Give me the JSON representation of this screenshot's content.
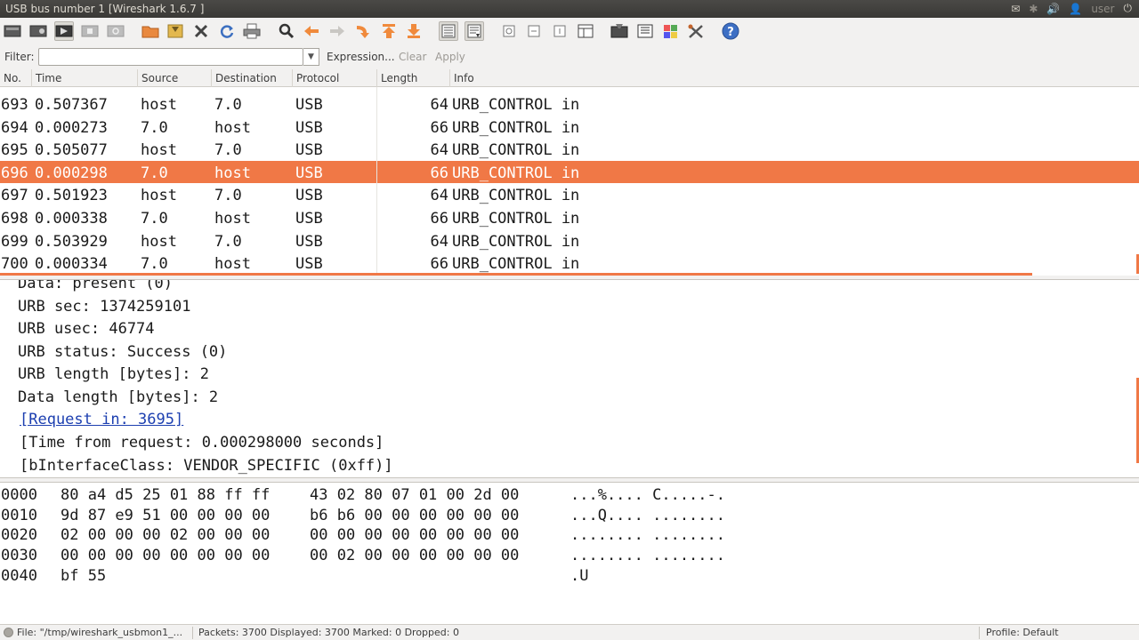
{
  "window": {
    "title": "USB bus number 1   [Wireshark 1.6.7 ]",
    "user": "user"
  },
  "toolbar": {
    "icons": [
      "interface-list-icon",
      "capture-options-icon",
      "start-capture-icon",
      "stop-capture-icon",
      "restart-capture-icon",
      "open-file-icon",
      "save-file-icon",
      "close-file-icon",
      "reload-icon",
      "print-icon",
      "find-icon",
      "go-back-icon",
      "go-forward-icon",
      "go-to-packet-icon",
      "go-first-icon",
      "go-last-icon",
      "colorize-icon",
      "autoscroll-icon",
      "zoom-in-icon",
      "zoom-out-icon",
      "normal-size-icon",
      "resize-columns-icon",
      "capture-filters-icon",
      "display-filters-icon",
      "coloring-rules-icon",
      "preferences-icon",
      "help-icon"
    ]
  },
  "filter": {
    "label": "Filter:",
    "value": "",
    "expression": "Expression...",
    "clear": "Clear",
    "apply": "Apply"
  },
  "packet_list": {
    "columns": [
      "No.",
      "Time",
      "Source",
      "Destination",
      "Protocol",
      "Length",
      "Info"
    ],
    "rows": [
      {
        "no": "693",
        "time": "0.507367",
        "src": "host",
        "dst": "7.0",
        "proto": "USB",
        "len": "64",
        "info": "URB_CONTROL in"
      },
      {
        "no": "694",
        "time": "0.000273",
        "src": "7.0",
        "dst": "host",
        "proto": "USB",
        "len": "66",
        "info": "URB_CONTROL in"
      },
      {
        "no": "695",
        "time": "0.505077",
        "src": "host",
        "dst": "7.0",
        "proto": "USB",
        "len": "64",
        "info": "URB_CONTROL in"
      },
      {
        "no": "696",
        "time": "0.000298",
        "src": "7.0",
        "dst": "host",
        "proto": "USB",
        "len": "66",
        "info": "URB_CONTROL in"
      },
      {
        "no": "697",
        "time": "0.501923",
        "src": "host",
        "dst": "7.0",
        "proto": "USB",
        "len": "64",
        "info": "URB_CONTROL in"
      },
      {
        "no": "698",
        "time": "0.000338",
        "src": "7.0",
        "dst": "host",
        "proto": "USB",
        "len": "66",
        "info": "URB_CONTROL in"
      },
      {
        "no": "699",
        "time": "0.503929",
        "src": "host",
        "dst": "7.0",
        "proto": "USB",
        "len": "64",
        "info": "URB_CONTROL in"
      },
      {
        "no": "700",
        "time": "0.000334",
        "src": "7.0",
        "dst": "host",
        "proto": "USB",
        "len": "66",
        "info": "URB_CONTROL in"
      }
    ],
    "selected_no": "696",
    "selection_color": "#f07846"
  },
  "details": {
    "lines": [
      "Data: present (0)",
      "URB sec: 1374259101",
      "URB usec: 46774",
      "URB status: Success (0)",
      "URB length [bytes]: 2",
      "Data length [bytes]: 2"
    ],
    "request_link": "[Request in: 3695]",
    "time_from_request": "[Time from request: 0.000298000 seconds]",
    "interface_class": "[bInterfaceClass: VENDOR_SPECIFIC (0xff)]"
  },
  "hex": {
    "rows": [
      {
        "offset": "0000",
        "b1": "80 a4 d5 25 01 88 ff ff",
        "b2": "43 02 80 07 01 00 2d 00",
        "ascii": "...%.... C.....-."
      },
      {
        "offset": "0010",
        "b1": "9d 87 e9 51 00 00 00 00",
        "b2": "b6 b6 00 00 00 00 00 00",
        "ascii": "...Q.... ........"
      },
      {
        "offset": "0020",
        "b1": "02 00 00 00 02 00 00 00",
        "b2": "00 00 00 00 00 00 00 00",
        "ascii": "........ ........"
      },
      {
        "offset": "0030",
        "b1": "00 00 00 00 00 00 00 00",
        "b2": "00 02 00 00 00 00 00 00",
        "ascii": "........ ........"
      },
      {
        "offset": "0040",
        "b1": "bf 55",
        "b2": "",
        "ascii": ".U"
      }
    ]
  },
  "status": {
    "file": "File: \"/tmp/wireshark_usbmon1_...",
    "packets": "Packets: 3700 Displayed: 3700 Marked: 0 Dropped: 0",
    "profile": "Profile: Default"
  }
}
